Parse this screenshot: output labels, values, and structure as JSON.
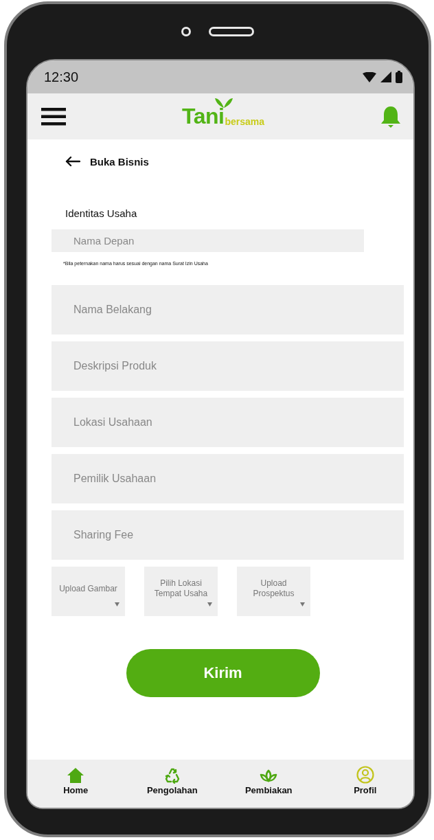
{
  "status_bar": {
    "time": "12:30"
  },
  "header": {
    "logo_main": "Tani",
    "logo_sub": "bersama"
  },
  "page": {
    "title": "Buka Bisnis"
  },
  "form": {
    "section_title": "Identitas Usaha",
    "fields": [
      {
        "placeholder": "Nama Depan",
        "note": "*Bila peternakan nama harus sesuai dengan nama Surat Izin Usaha"
      },
      {
        "placeholder": "Nama Belakang"
      },
      {
        "placeholder": "Deskripsi Produk"
      },
      {
        "placeholder": "Lokasi Usahaan"
      },
      {
        "placeholder": "Pemilik Usahaan"
      },
      {
        "placeholder": "Sharing Fee"
      }
    ],
    "selects": [
      {
        "label": "Upload Gambar"
      },
      {
        "label": "Pilih Lokasi Tempat Usaha"
      },
      {
        "label": "Upload Prospektus"
      }
    ],
    "submit": "Kirim"
  },
  "bottom_nav": [
    {
      "label": "Home",
      "kind": "home"
    },
    {
      "label": "Pengolahan",
      "kind": "recycle"
    },
    {
      "label": "Pembiakan",
      "kind": "plant"
    },
    {
      "label": "Profil",
      "kind": "profile"
    }
  ]
}
